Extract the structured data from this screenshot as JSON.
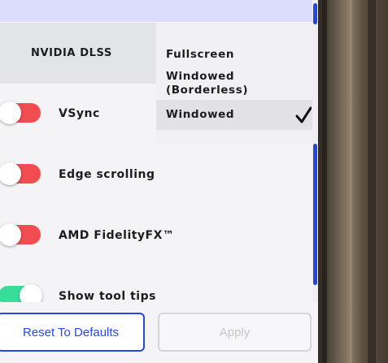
{
  "settings": {
    "upscaler_header": "NVIDIA DLSS",
    "rows": [
      {
        "label": "VSync",
        "state": "off"
      },
      {
        "label": "Edge scrolling",
        "state": "off"
      },
      {
        "label": "AMD FidelityFX™",
        "state": "off"
      },
      {
        "label": "Show tool tips",
        "state": "on"
      }
    ]
  },
  "display_mode_dropdown": {
    "options": [
      "Fullscreen",
      "Windowed\n(Borderless)",
      "Windowed"
    ],
    "selected": "Windowed",
    "selected_icon": "checkmark-icon"
  },
  "footer": {
    "reset_label": "Reset To Defaults",
    "apply_label": "Apply"
  },
  "colors": {
    "accent": "#2548e4",
    "toggle_off": "#f14c4f",
    "toggle_on": "#39dd9a",
    "top_strip": "#dcdcfd"
  }
}
